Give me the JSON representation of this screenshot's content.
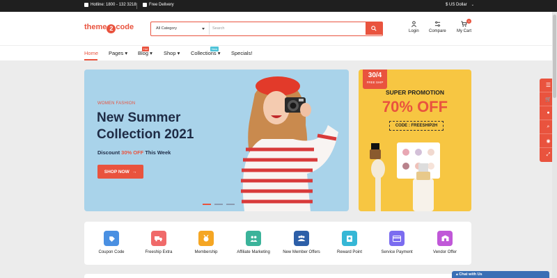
{
  "topbar": {
    "hotline": "Hotline: 1800 - 132 3218",
    "delivery": "Free Delivery",
    "currency": "$ US Dollar"
  },
  "header": {
    "logo_left": "theme",
    "logo_mid": "2",
    "logo_right": "code",
    "category": "All Category",
    "search_placeholder": "Search",
    "login": "Login",
    "compare": "Compare",
    "cart": "My Cart",
    "cart_count": "0"
  },
  "nav": {
    "items": [
      {
        "label": "Home"
      },
      {
        "label": "Pages"
      },
      {
        "label": "Blog",
        "badge": "Hot"
      },
      {
        "label": "Shop"
      },
      {
        "label": "Collections",
        "badge": "New"
      },
      {
        "label": "Specials!"
      }
    ],
    "colors": {
      "hot": "#e9533e",
      "new": "#4fc3d8"
    }
  },
  "banner": {
    "eyebrow": "WOMEN FASHION",
    "title_1": "New Summer",
    "title_2": "Collection 2021",
    "discount_pre": "Discount ",
    "discount_hl": "30% OFF",
    "discount_post": " This Week",
    "button": "SHOP NOW"
  },
  "promo": {
    "date": "30/4",
    "tag": "FREE SHIP",
    "heading": "SUPER PROMOTION",
    "discount": "70% OFF",
    "code": "CODE : FREESHIP2H"
  },
  "services": [
    {
      "label": "Coupon Code",
      "color": "#4a90e2",
      "icon": "coupon-icon"
    },
    {
      "label": "Freeship Extra",
      "color": "#f06a6a",
      "icon": "truck-icon"
    },
    {
      "label": "Membership",
      "color": "#f5a623",
      "icon": "medal-icon"
    },
    {
      "label": "Affiliate Marketing",
      "color": "#3bb39a",
      "icon": "affiliate-icon"
    },
    {
      "label": "New Member Offers",
      "color": "#2d5fa8",
      "icon": "group-icon"
    },
    {
      "label": "Reward Point",
      "color": "#36b7d6",
      "icon": "reward-icon"
    },
    {
      "label": "Service Payment",
      "color": "#7b6cf0",
      "icon": "card-icon"
    },
    {
      "label": "Vendor Offer",
      "color": "#c058d8",
      "icon": "vendor-icon"
    }
  ],
  "chat": {
    "label": "Chat with Us"
  },
  "colors": {
    "accent": "#e9533e",
    "navy": "#1e2b45",
    "promo_bg": "#f7c642",
    "banner_bg": "#a9d3ea"
  }
}
